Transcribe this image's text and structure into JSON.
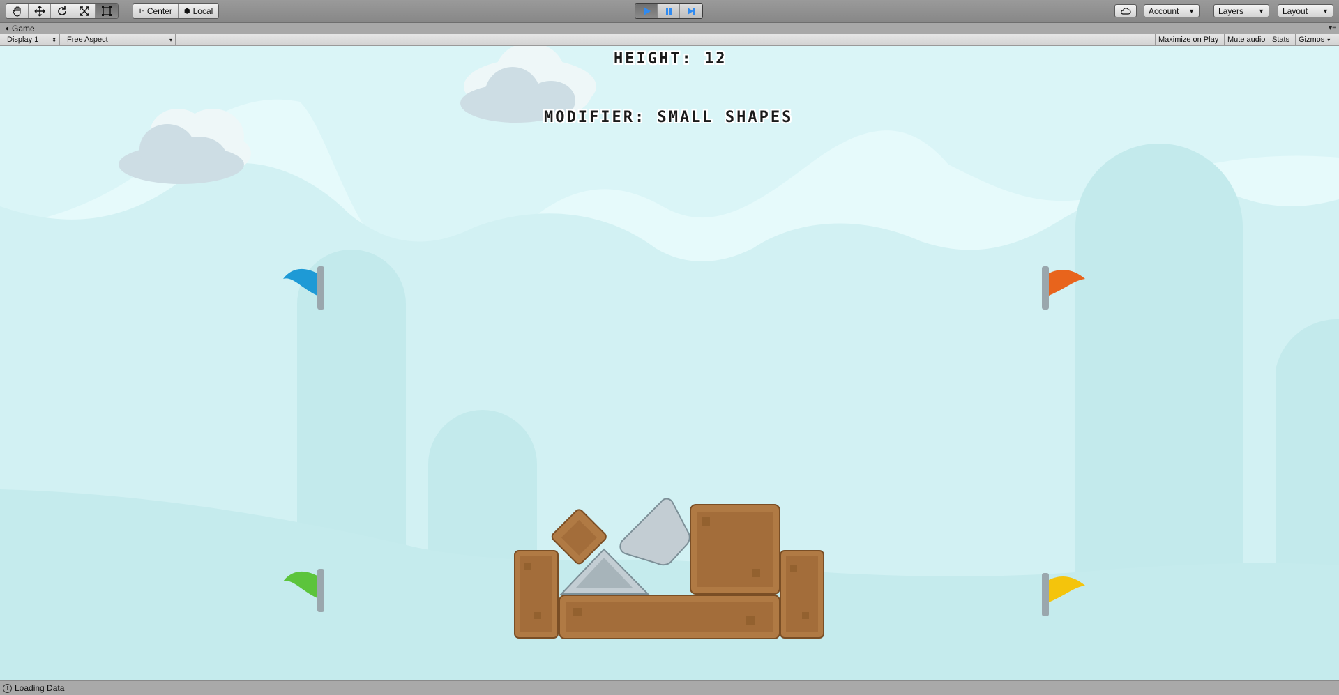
{
  "toolbar": {
    "tools": [
      {
        "icon": "hand-tool-icon"
      },
      {
        "icon": "move-tool-icon"
      },
      {
        "icon": "rotate-tool-icon"
      },
      {
        "icon": "scale-tool-icon"
      },
      {
        "icon": "rect-tool-icon"
      }
    ],
    "pivot_center": "Center",
    "pivot_local": "Local",
    "play": {
      "play_active": true
    },
    "account_label": "Account",
    "layers_label": "Layers",
    "layout_label": "Layout"
  },
  "panel": {
    "tab_label": "Game",
    "display_label": "Display 1",
    "aspect_label": "Free Aspect",
    "maximize_label": "Maximize on Play",
    "mute_label": "Mute audio",
    "stats_label": "Stats",
    "gizmos_label": "Gizmos"
  },
  "game": {
    "height_text": "HEIGHT: 12",
    "modifier_text": "MODIFIER: SMALL SHAPES",
    "flags": [
      {
        "color": "#1e9ad6",
        "name": "blue"
      },
      {
        "color": "#e8641c",
        "name": "orange"
      },
      {
        "color": "#5cc43c",
        "name": "green"
      },
      {
        "color": "#f4c40c",
        "name": "yellow"
      }
    ],
    "colors": {
      "sky": "#e6fafb",
      "hills_far": "#d6f3f5",
      "hills_near": "#c7ecee",
      "crate": "#b07a44",
      "stone": "#c3cdd3"
    }
  },
  "status": {
    "text": "Loading Data"
  }
}
